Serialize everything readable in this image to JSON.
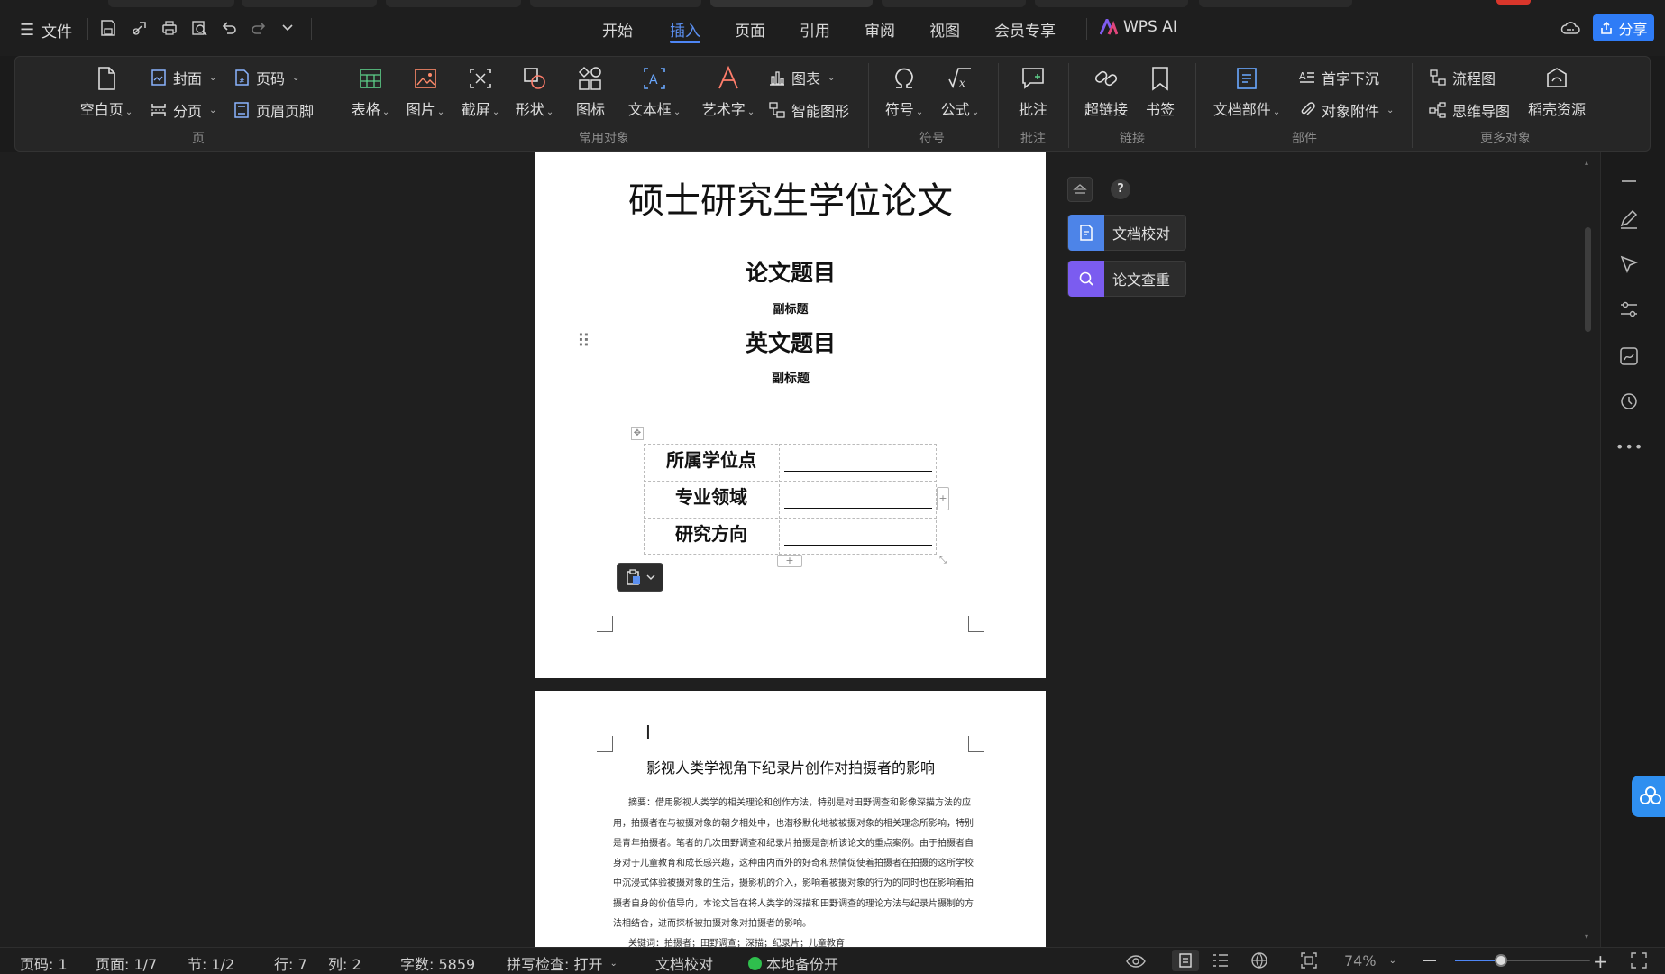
{
  "topbar": {
    "menu_label": "文件",
    "nav_tabs": [
      "开始",
      "插入",
      "页面",
      "引用",
      "审阅",
      "视图",
      "会员专享"
    ],
    "active_tab": "插入",
    "wps_ai": "WPS AI",
    "share": "分享"
  },
  "ribbon": {
    "page_group": {
      "blank_page": "空白页",
      "cover": "封面",
      "page_break": "分页",
      "page_number": "页码",
      "header_footer": "页眉页脚",
      "label": "页"
    },
    "objects_group": {
      "table": "表格",
      "picture": "图片",
      "screenshot": "截屏",
      "shape": "形状",
      "icon": "图标",
      "textbox": "文本框",
      "wordart": "艺术字",
      "chart": "图表",
      "smart_graphic": "智能图形",
      "label": "常用对象"
    },
    "symbol_group": {
      "symbol": "符号",
      "formula": "公式",
      "label": "符号"
    },
    "comment_group": {
      "comment": "批注",
      "label": "批注"
    },
    "link_group": {
      "hyperlink": "超链接",
      "bookmark": "书签",
      "label": "链接"
    },
    "parts_group": {
      "doc_parts": "文档部件",
      "drop_cap": "首字下沉",
      "attachment": "对象附件",
      "label": "部件"
    },
    "more_group": {
      "flowchart": "流程图",
      "mindmap": "思维导图",
      "resources": "稻壳资源",
      "label": "更多对象"
    }
  },
  "document": {
    "page1": {
      "title": "硕士研究生学位论文",
      "thesis_title": "论文题目",
      "subtitle1": "副标题",
      "english_title": "英文题目",
      "subtitle2": "副标题",
      "table_rows": [
        "所属学位点",
        "专业领域",
        "研究方向"
      ]
    },
    "page2": {
      "title": "影视人类学视角下纪录片创作对拍摄者的影响",
      "abstract_lines": [
        "摘要：借用影视人类学的相关理论和创作方法，特别是对田野调查和影像深描方法的应",
        "用，拍摄者在与被摄对象的朝夕相处中，也潜移默化地被被摄对象的相关理念所影响，特别",
        "是青年拍摄者。笔者的几次田野调查和纪录片拍摄是剖析该论文的重点案例。由于拍摄者自",
        "身对于儿童教育和成长感兴趣，这种由内而外的好奇和热情促使着拍摄者在拍摄的这所学校",
        "中沉浸式体验被摄对象的生活，摄影机的介入，影响着被摄对象的行为的同时也在影响着拍",
        "摄者自身的价值导向，本论文旨在将人类学的深描和田野调查的理论方法与纪录片摄制的方",
        "法相结合，进而探析被拍摄对象对拍摄者的影响。"
      ],
      "keywords": "关键词：拍摄者；田野调查；深描；纪录片；儿童教育"
    }
  },
  "side_panel": {
    "proofread": "文档校对",
    "plagiarism": "论文查重",
    "help": "?"
  },
  "statusbar": {
    "page_code": "页码: 1",
    "page": "页面: 1/7",
    "section": "节: 1/2",
    "row": "行: 7",
    "col": "列: 2",
    "word_count": "字数: 5859",
    "spell_check": "拼写检查: 打开",
    "proof": "文档校对",
    "backup": "本地备份开",
    "zoom": "74%"
  },
  "colors": {
    "accent": "#4e86f5",
    "backup_green": "#2fbf4d",
    "share_bg": "#2f7cf6"
  }
}
